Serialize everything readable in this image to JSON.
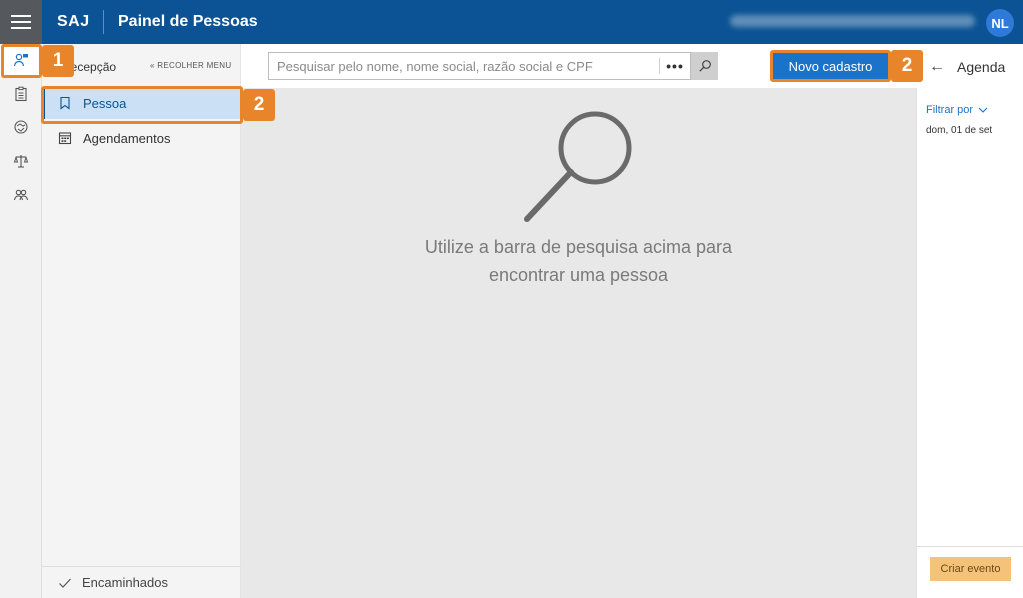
{
  "topbar": {
    "brand": "SAJ",
    "title": "Painel de Pessoas",
    "user_initials": "NL"
  },
  "rail": {
    "icons": [
      "person-list-icon",
      "clipboard-icon",
      "handshake-icon",
      "scales-icon",
      "group-icon"
    ]
  },
  "sidemenu": {
    "title": "Recepção",
    "collapse_label": "RECOLHER MENU",
    "items": [
      {
        "label": "Pessoa",
        "icon": "bookmark-icon",
        "active": true
      },
      {
        "label": "Agendamentos",
        "icon": "calendar-icon",
        "active": false
      }
    ],
    "footer_label": "Encaminhados"
  },
  "search": {
    "placeholder": "Pesquisar pelo nome, nome social, razão social e CPF",
    "value": "",
    "more_label": "•••"
  },
  "toolbar": {
    "new_button_label": "Novo cadastro",
    "agenda_label": "Agenda"
  },
  "empty_state": {
    "line1": "Utilize a barra de pesquisa acima para",
    "line2": "encontrar uma pessoa"
  },
  "agenda": {
    "filter_label": "Filtrar por",
    "date_label": "dom, 01 de set",
    "create_button_label": "Criar evento"
  },
  "callouts": {
    "rail_number": "1",
    "menu_number": "2",
    "button_number": "2"
  },
  "colors": {
    "topbar": "#0b5394",
    "accent": "#1a73c9",
    "callout": "#e8852a",
    "create_button": "#f5c27a"
  }
}
